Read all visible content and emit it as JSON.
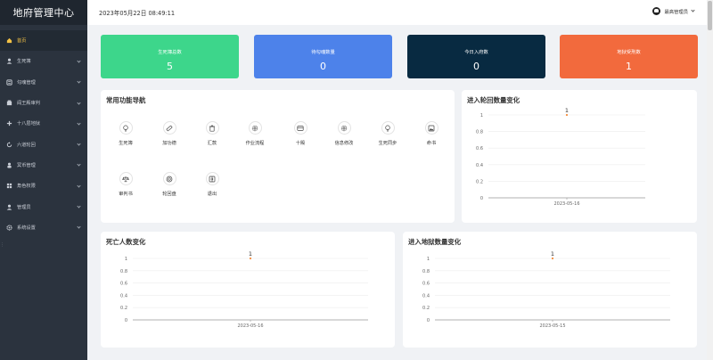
{
  "app": {
    "title": "地府管理中心"
  },
  "header": {
    "datetime": "2023年05月22日 08:49:11",
    "user": "最高管理员"
  },
  "sidebar": {
    "items": [
      {
        "label": "首页",
        "icon": "home-icon",
        "active": true,
        "expandable": false
      },
      {
        "label": "生死簿",
        "icon": "user-icon",
        "expandable": true
      },
      {
        "label": "勾魂管理",
        "icon": "note-icon",
        "expandable": true
      },
      {
        "label": "阎王殿审判",
        "icon": "gavel-icon",
        "expandable": true
      },
      {
        "label": "十八层地狱",
        "icon": "plus-icon",
        "expandable": true
      },
      {
        "label": "六道轮回",
        "icon": "refresh-icon",
        "expandable": true
      },
      {
        "label": "冥币管理",
        "icon": "person-icon",
        "expandable": true
      },
      {
        "label": "角色权限",
        "icon": "grid-icon",
        "expandable": true
      },
      {
        "label": "管理员",
        "icon": "user-icon",
        "expandable": true
      },
      {
        "label": "系统设置",
        "icon": "settings-icon",
        "expandable": true
      }
    ]
  },
  "stats": [
    {
      "label": "生死簿总数",
      "value": "5",
      "color": "#3dd68b"
    },
    {
      "label": "待勾魂数量",
      "value": "0",
      "color": "#4d82ea"
    },
    {
      "label": "今日入府数",
      "value": "0",
      "color": "#082a41"
    },
    {
      "label": "地狱受刑数",
      "value": "1",
      "color": "#f26a3d"
    }
  ],
  "quick_nav": {
    "title": "常用功能导航",
    "items": [
      {
        "label": "生死簿",
        "icon": "bulb-icon"
      },
      {
        "label": "加功德",
        "icon": "ruler-icon"
      },
      {
        "label": "汇款",
        "icon": "trash-icon"
      },
      {
        "label": "作业流程",
        "icon": "gear-icon"
      },
      {
        "label": "十殿",
        "icon": "card-icon"
      },
      {
        "label": "信息修改",
        "icon": "gear-icon"
      },
      {
        "label": "生死同步",
        "icon": "bulb-icon"
      },
      {
        "label": "命书",
        "icon": "image-icon"
      },
      {
        "label": "审判书",
        "icon": "scale-icon"
      },
      {
        "label": "轮回盘",
        "icon": "target-icon"
      },
      {
        "label": "退出",
        "icon": "exit-icon"
      }
    ]
  },
  "chart_data": [
    {
      "type": "line",
      "title": "进入轮回数量变化",
      "categories": [
        "2023-05-16"
      ],
      "values": [
        1
      ],
      "ylim": [
        0,
        1
      ],
      "yticks": [
        "0",
        "0.2",
        "0.4",
        "0.6",
        "0.8",
        "1"
      ],
      "data_label": "1",
      "color": "#f58c3c",
      "grid": true
    },
    {
      "type": "line",
      "title": "死亡人数变化",
      "categories": [
        "2023-05-16"
      ],
      "values": [
        1
      ],
      "ylim": [
        0,
        1
      ],
      "yticks": [
        "0",
        "0.2",
        "0.4",
        "0.6",
        "0.8",
        "1"
      ],
      "data_label": "1",
      "color": "#f58c3c",
      "grid": true
    },
    {
      "type": "line",
      "title": "进入地狱数量变化",
      "categories": [
        "2023-05-15"
      ],
      "values": [
        1
      ],
      "ylim": [
        0,
        1
      ],
      "yticks": [
        "0",
        "0.2",
        "0.4",
        "0.6",
        "0.8",
        "1"
      ],
      "data_label": "1",
      "color": "#f58c3c",
      "grid": true
    }
  ]
}
